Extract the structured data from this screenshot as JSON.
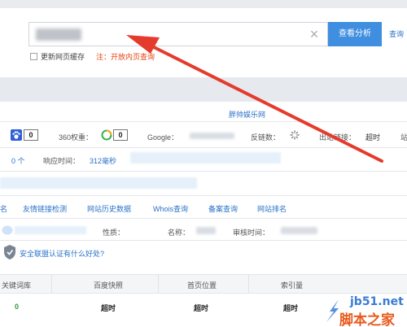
{
  "search": {
    "button_label": "查看分析",
    "side_link": "查询"
  },
  "options": {
    "cache_label": "更新网页缓存",
    "cache_note": "注：开放内页查询"
  },
  "site": {
    "name": "胖帅娱乐网"
  },
  "metrics": {
    "baidu_badge": "0",
    "so360_label": "360权重：",
    "so360_badge": "0",
    "google_label": "Google：",
    "backlinks_label": "反链数：",
    "outlinks_label": "出站链接：",
    "outlinks_value": "超时",
    "trailing_label": "站",
    "count_value": "0 个",
    "response_label": "响应时间：",
    "response_value": "312毫秒"
  },
  "tabs": [
    "名",
    "友情链接检测",
    "网站历史数据",
    "Whois查询",
    "备案查询",
    "网站排名"
  ],
  "info": {
    "nature_label": "性质：",
    "name_label": "名称：",
    "audit_label": "审核时间："
  },
  "security": {
    "link_text": "安全联盟认证有什么好处?"
  },
  "table": {
    "headers": [
      "关键词库",
      "百度快照",
      "首页位置",
      "索引量"
    ],
    "row": [
      "0",
      "超时",
      "超时",
      "超时"
    ]
  },
  "watermark": {
    "url": "jb51.net",
    "brand": "脚本之家"
  },
  "colors": {
    "accent": "#3f8ee0",
    "link": "#2a72c8",
    "note": "#e4420f",
    "arrow": "#e53b2c"
  },
  "icons": [
    "paw-icon",
    "circle-icon",
    "spinner-icon",
    "clear-icon",
    "shield-icon",
    "arrow-annotation"
  ]
}
